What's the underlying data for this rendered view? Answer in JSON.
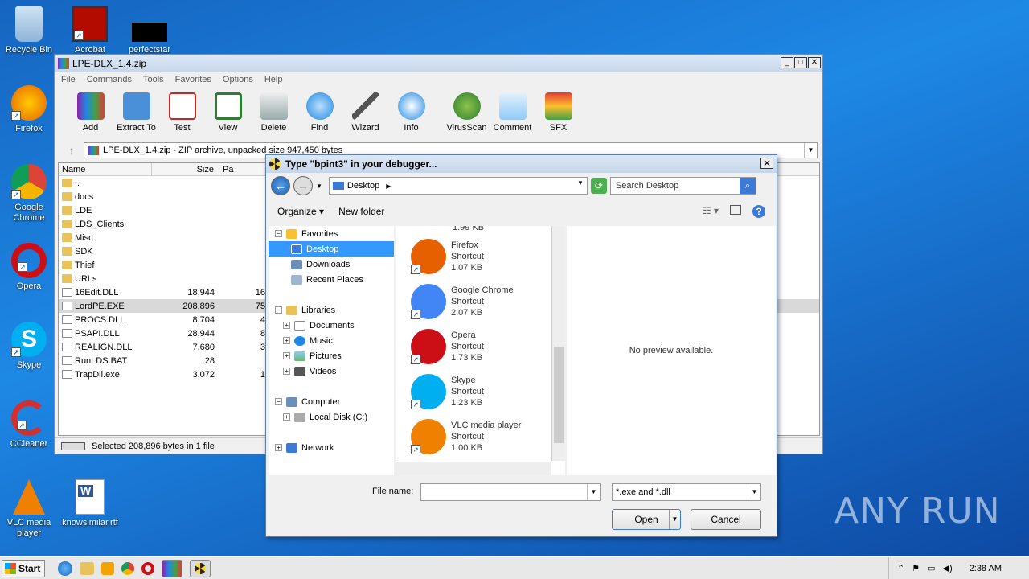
{
  "desktop": {
    "icons": [
      {
        "label": "Recycle Bin",
        "icon": "recycle-bin-icon"
      },
      {
        "label": "Acrobat",
        "icon": "acrobat-icon"
      },
      {
        "label": "perfectstar",
        "icon": "blank-icon"
      },
      {
        "label": "Firefox",
        "icon": "firefox-icon"
      },
      {
        "label": "Google Chrome",
        "icon": "chrome-icon"
      },
      {
        "label": "Opera",
        "icon": "opera-icon"
      },
      {
        "label": "Skype",
        "icon": "skype-icon"
      },
      {
        "label": "CCleaner",
        "icon": "ccleaner-icon"
      },
      {
        "label": "VLC media player",
        "icon": "vlc-icon"
      },
      {
        "label": "knowsimilar.rtf",
        "icon": "word-doc-icon"
      }
    ]
  },
  "winrar": {
    "title": "LPE-DLX_1.4.zip",
    "menu": [
      "File",
      "Commands",
      "Tools",
      "Favorites",
      "Options",
      "Help"
    ],
    "toolbar": [
      "Add",
      "Extract To",
      "Test",
      "View",
      "Delete",
      "Find",
      "Wizard",
      "Info",
      "VirusScan",
      "Comment",
      "SFX"
    ],
    "address": "LPE-DLX_1.4.zip - ZIP archive, unpacked size 947,450 bytes",
    "columns": {
      "name": "Name",
      "size": "Size",
      "packed": "Pa"
    },
    "files": [
      {
        "name": "..",
        "size": "",
        "packed": "",
        "type": "folder"
      },
      {
        "name": "docs",
        "size": "",
        "packed": "",
        "type": "folder"
      },
      {
        "name": "LDE",
        "size": "",
        "packed": "",
        "type": "folder"
      },
      {
        "name": "LDS_Clients",
        "size": "",
        "packed": "",
        "type": "folder"
      },
      {
        "name": "Misc",
        "size": "",
        "packed": "",
        "type": "folder"
      },
      {
        "name": "SDK",
        "size": "",
        "packed": "",
        "type": "folder"
      },
      {
        "name": "Thief",
        "size": "",
        "packed": "",
        "type": "folder"
      },
      {
        "name": "URLs",
        "size": "",
        "packed": "",
        "type": "folder"
      },
      {
        "name": "16Edit.DLL",
        "size": "18,944",
        "packed": "16,",
        "type": "file"
      },
      {
        "name": "LordPE.EXE",
        "size": "208,896",
        "packed": "75,",
        "type": "file"
      },
      {
        "name": "PROCS.DLL",
        "size": "8,704",
        "packed": "4,",
        "type": "file"
      },
      {
        "name": "PSAPI.DLL",
        "size": "28,944",
        "packed": "8,",
        "type": "file"
      },
      {
        "name": "REALIGN.DLL",
        "size": "7,680",
        "packed": "3,",
        "type": "file"
      },
      {
        "name": "RunLDS.BAT",
        "size": "28",
        "packed": "",
        "type": "file"
      },
      {
        "name": "TrapDll.exe",
        "size": "3,072",
        "packed": "1,",
        "type": "file"
      }
    ],
    "status": "Selected 208,896 bytes in 1 file"
  },
  "dialog": {
    "title": "Type \"bpint3\" in your debugger...",
    "path": "Desktop",
    "search_placeholder": "Search Desktop",
    "organize": "Organize",
    "new_folder": "New folder",
    "nav": {
      "favorites": "Favorites",
      "desktop": "Desktop",
      "downloads": "Downloads",
      "recent": "Recent Places",
      "libraries": "Libraries",
      "documents": "Documents",
      "music": "Music",
      "pictures": "Pictures",
      "videos": "Videos",
      "computer": "Computer",
      "local_disk": "Local Disk (C:)",
      "network": "Network"
    },
    "partial_item_size": "1.99 KB",
    "items": [
      {
        "name": "Firefox",
        "type": "Shortcut",
        "size": "1.07 KB",
        "icon": "firefox-icon",
        "color": "#e66000"
      },
      {
        "name": "Google Chrome",
        "type": "Shortcut",
        "size": "2.07 KB",
        "icon": "chrome-icon",
        "color": "#4285f4"
      },
      {
        "name": "Opera",
        "type": "Shortcut",
        "size": "1.73 KB",
        "icon": "opera-icon",
        "color": "#cc0f16"
      },
      {
        "name": "Skype",
        "type": "Shortcut",
        "size": "1.23 KB",
        "icon": "skype-icon",
        "color": "#00aff0"
      },
      {
        "name": "VLC media player",
        "type": "Shortcut",
        "size": "1.00 KB",
        "icon": "vlc-icon",
        "color": "#f08000"
      }
    ],
    "preview_text": "No preview available.",
    "file_name_label": "File name:",
    "file_name_value": "",
    "file_type": "*.exe and *.dll",
    "open": "Open",
    "cancel": "Cancel"
  },
  "taskbar": {
    "start": "Start",
    "clock": "2:38 AM"
  },
  "watermark": "ANY RUN"
}
